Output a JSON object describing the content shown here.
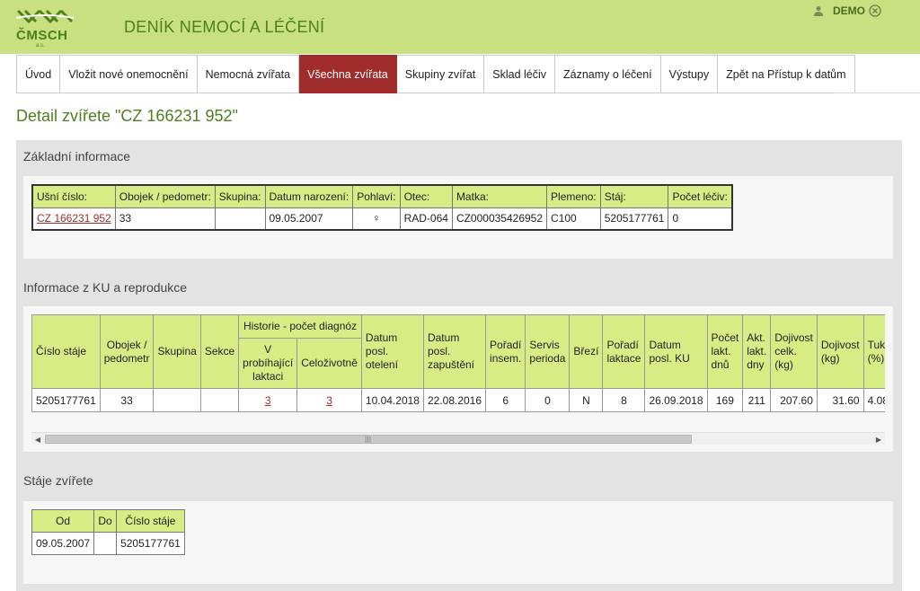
{
  "header": {
    "logo_text": "ČMSCH",
    "logo_sub": "a.s.",
    "app_title": "DENÍK NEMOCÍ A LÉČENÍ",
    "user_name": "DEMO",
    "brand_color": "#c8e07f",
    "title_color": "#4d7f1e"
  },
  "nav": {
    "items": [
      {
        "label": "Úvod",
        "active": false
      },
      {
        "label": "Vložit nové onemocnění",
        "active": false
      },
      {
        "label": "Nemocná zvířata",
        "active": false
      },
      {
        "label": "Všechna zvířata",
        "active": true
      },
      {
        "label": "Skupiny zvířat",
        "active": false
      },
      {
        "label": "Sklad léčiv",
        "active": false
      },
      {
        "label": "Záznamy o léčení",
        "active": false
      },
      {
        "label": "Výstupy",
        "active": false
      },
      {
        "label": "Zpět na Přístup k datům",
        "active": false
      }
    ],
    "active_color": "#a02c2c"
  },
  "page_title": "Detail zvířete \"CZ 166231 952\"",
  "basic": {
    "title": "Základní informace",
    "headers": [
      "Ušní číslo:",
      "Obojek / pedometr:",
      "Skupina:",
      "Datum narození:",
      "Pohlaví:",
      "Otec:",
      "Matka:",
      "Plemeno:",
      "Stáj:",
      "Počet léčiv:"
    ],
    "row": {
      "ear_number": "CZ 166231 952",
      "collar": "33",
      "group": "",
      "birth_date": "09.05.2007",
      "sex": "♀",
      "father": "RAD-064",
      "mother": "CZ000035426952",
      "breed": "C100",
      "stable": "5205177761",
      "drug_count": "0"
    }
  },
  "ku": {
    "title": "Informace z KU a reprodukce",
    "headers": {
      "stable_no": "Číslo stáje",
      "collar": "Obojek / pedometr",
      "group": "Skupina",
      "section": "Sekce",
      "history": "Historie - počet diagnóz",
      "history_current": "V probíhající laktaci",
      "history_lifetime": "Celoživotně",
      "last_calving": "Datum posl. otelení",
      "last_dryoff": "Datum posl. zapuštění",
      "insem_order": "Pořadí insem.",
      "service_period": "Servis perioda",
      "pregnant": "Březí",
      "lact_order": "Pořadí laktace",
      "last_ku": "Datum posl. KU",
      "lact_days": "Počet lakt. dnů",
      "act_lact_days": "Akt. lakt. dny",
      "total_yield": "Dojivost celk. (kg)",
      "yield": "Dojivost (kg)",
      "fat": "Tuk (%)"
    },
    "row": {
      "stable_no": "5205177761",
      "collar": "33",
      "group": "",
      "section": "",
      "history_current": "3",
      "history_lifetime": "3",
      "last_calving": "10.04.2018",
      "last_dryoff": "22.08.2016",
      "insem_order": "6",
      "service_period": "0",
      "pregnant": "N",
      "lact_order": "8",
      "last_ku": "26.09.2018",
      "lact_days": "169",
      "act_lact_days": "211",
      "total_yield": "207.60",
      "yield": "31.60",
      "fat": "4.08"
    }
  },
  "stables": {
    "title": "Stáje zvířete",
    "headers": [
      "Od",
      "Do",
      "Číslo stáje"
    ],
    "rows": [
      {
        "from": "09.05.2007",
        "to": "",
        "stable": "5205177761"
      }
    ]
  }
}
